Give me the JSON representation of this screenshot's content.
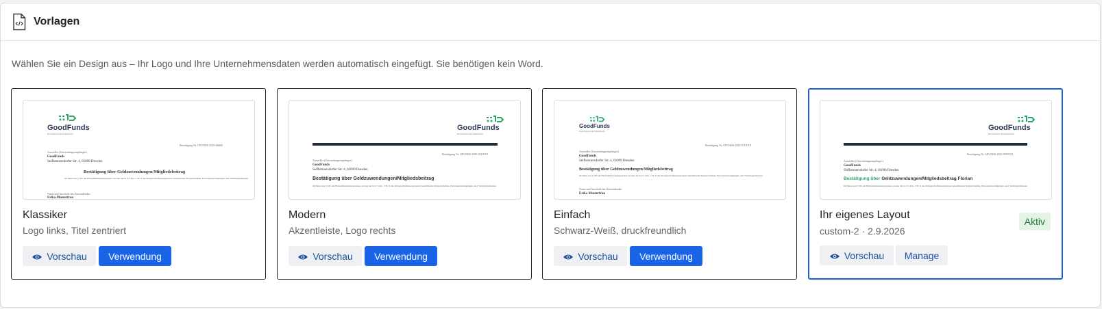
{
  "header": {
    "title": "Vorlagen",
    "icon": "code-file-icon"
  },
  "intro": "Wählen Sie ein Design aus – Ihr Logo und Ihre Unternehmensdaten werden automatisch eingefügt. Sie benötigen kein Word.",
  "preview_doc": {
    "logo_text": "GoodFunds",
    "logo_tagline": "Das Netzwerk für Gemeinwohl",
    "sender_label": "Aussteller (Zuwendungsempfänger)",
    "org_name": "GoodFunds",
    "org_address": "Seifhennersdorfer Str. 4, 01099 Dresden",
    "heading": "Bestätigung über Geldzuwendungen/Mitgliedsbeitrag",
    "body": "im Sinne des § 10b des Einkommensteuergesetzes an eine der in § 5 Abs. 1 Nr. 9 des Körperschaftsteuergesetzes bezeichneten Körperschaften, Personenvereinigungen oder Vermögensmassen",
    "donor_label": "Name und Anschrift des Zuwendenden",
    "donor_name": "Erika Musterfrau",
    "ref_classic": "Bestätigung Nr. GFUNDS-2025-00009",
    "ref_generic": "Bestätigung Nr. GFUNDS-2025-XXXXX",
    "custom_heading_accent": "Bestätigung über",
    "custom_heading_rest": "Geldzuwendungen/Mitgliedsbeitrag Florian"
  },
  "templates": [
    {
      "name": "Klassiker",
      "desc": "Logo links, Titel zentriert",
      "preview_label": "Vorschau",
      "use_label": "Verwendung"
    },
    {
      "name": "Modern",
      "desc": "Akzentleiste, Logo rechts",
      "preview_label": "Vorschau",
      "use_label": "Verwendung"
    },
    {
      "name": "Einfach",
      "desc": "Schwarz-Weiß, druckfreundlich",
      "preview_label": "Vorschau",
      "use_label": "Verwendung"
    },
    {
      "name": "Ihr eigenes Layout",
      "desc": "custom-2 · 2.9.2026",
      "badge": "Aktiv",
      "preview_label": "Vorschau",
      "manage_label": "Manage"
    }
  ],
  "colors": {
    "primary": "#1a64e8",
    "active_border": "#1a5fd0",
    "badge_bg": "#e3f4e6",
    "badge_text": "#1d7a35",
    "logo_green": "#2aa66a",
    "accent_bar": "#1f2a3a"
  }
}
